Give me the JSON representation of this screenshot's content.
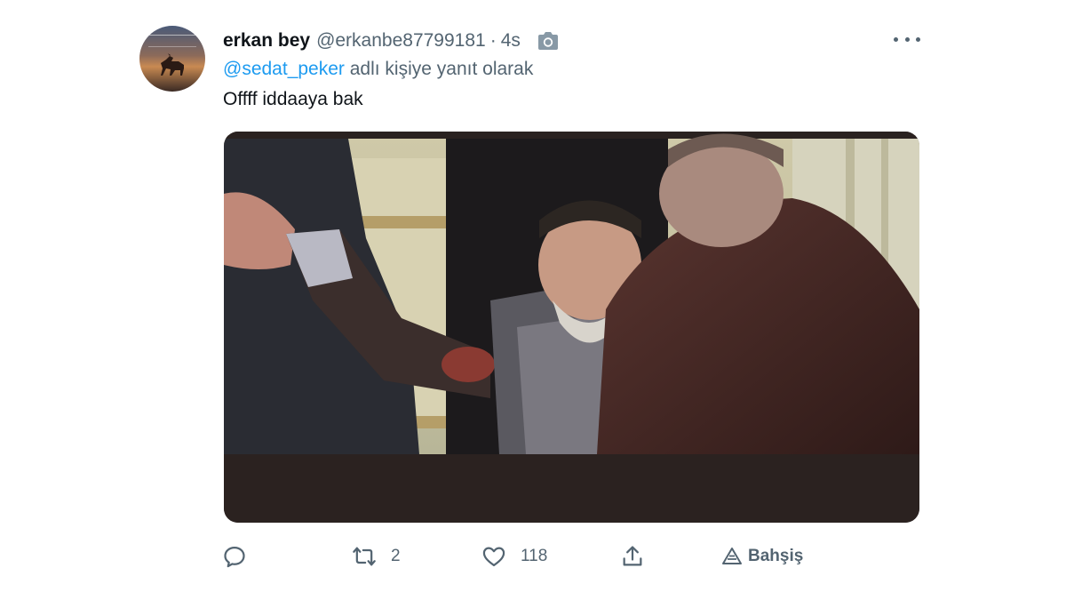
{
  "tweet": {
    "display_name": "erkan bey",
    "handle": "@erkanbe87799181",
    "separator": "·",
    "time": "4s",
    "reply_to": {
      "mention": "@sedat_peker",
      "suffix": " adlı kişiye yanıt olarak"
    },
    "text": "Offff iddaaya bak"
  },
  "actions": {
    "reply_count": "",
    "retweet_count": "2",
    "like_count": "118",
    "tip_label": "Bahşiş"
  },
  "icons": {
    "camera": "camera-icon",
    "more": "more-icon",
    "reply": "reply-icon",
    "retweet": "retweet-icon",
    "like": "heart-icon",
    "share": "share-icon",
    "tip": "tip-icon"
  },
  "colors": {
    "link": "#1d9bf0",
    "secondary_text": "#536471",
    "primary_text": "#0f1419"
  }
}
